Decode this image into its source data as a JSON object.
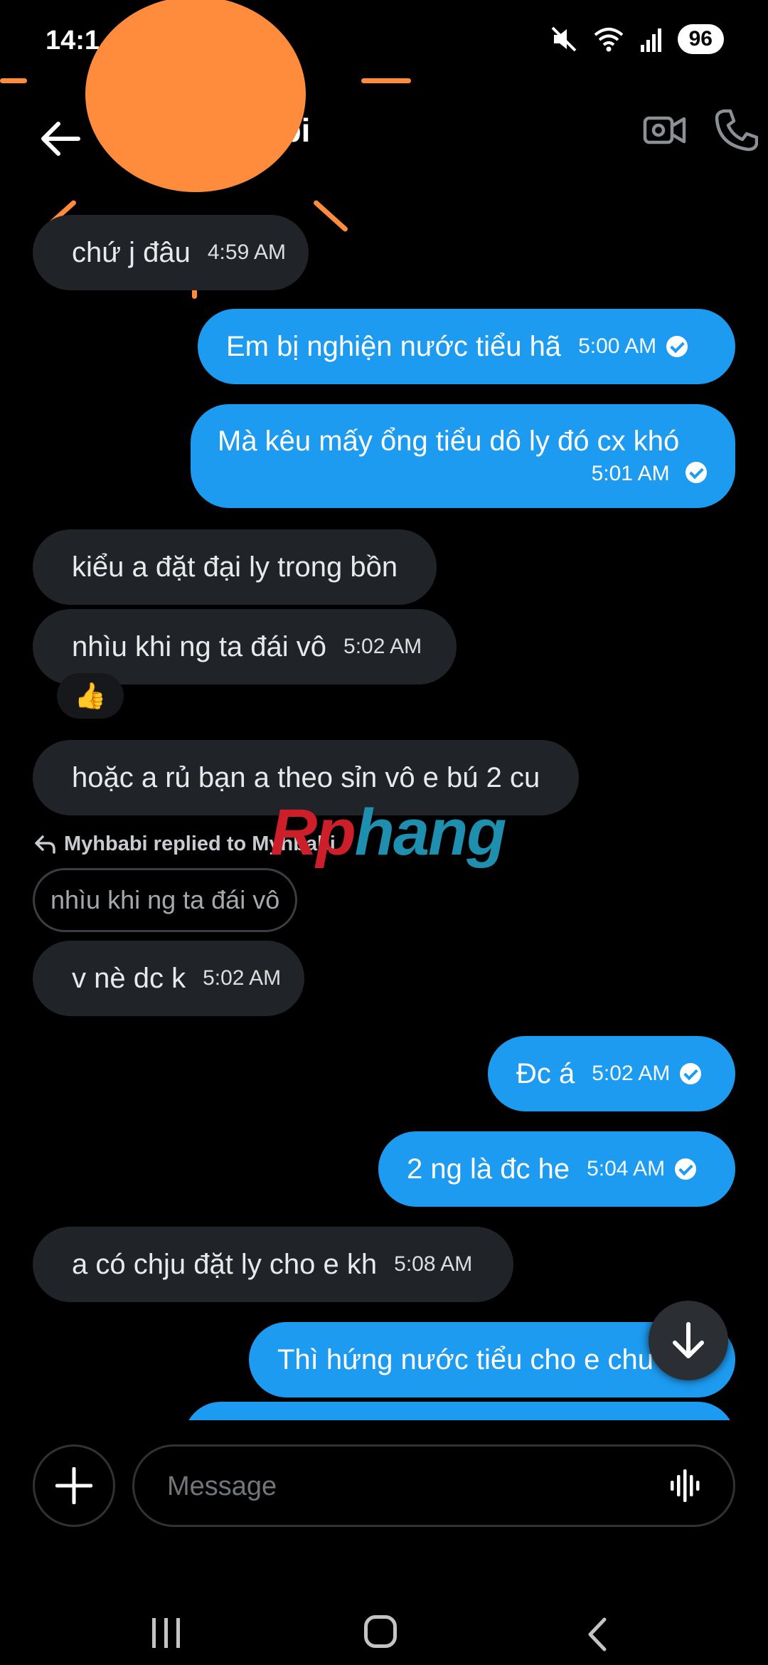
{
  "status_bar": {
    "time": "14:1",
    "battery": "96"
  },
  "header": {
    "name_fragment": "abi"
  },
  "messages": [
    {
      "id": "m1",
      "text": "chứ j đâu",
      "time": "4:59 AM"
    },
    {
      "id": "m2",
      "text": "Em bị nghiện nước tiểu hã",
      "time": "5:00 AM"
    },
    {
      "id": "m3",
      "text": "Mà kêu mấy ổng tiểu dô ly đó cx khó",
      "time": "5:01 AM"
    },
    {
      "id": "m4",
      "text": "kiểu a đặt đại ly trong bồn"
    },
    {
      "id": "m5",
      "text": "nhìu khi ng ta đái vô",
      "time": "5:02 AM",
      "reaction": "👍"
    },
    {
      "id": "m6",
      "text": "hoặc a rủ bạn a theo sỉn vô e bú 2 cu"
    },
    {
      "id": "m7",
      "text": "v nè dc k",
      "time": "5:02 AM"
    },
    {
      "id": "m8",
      "text": "Đc á",
      "time": "5:02 AM"
    },
    {
      "id": "m9",
      "text": "2 ng là đc he",
      "time": "5:04 AM"
    },
    {
      "id": "m10",
      "text": "a có chju đặt ly cho e kh",
      "time": "5:08 AM"
    },
    {
      "id": "m11",
      "text": "Thì hứng nước tiểu cho e chu"
    }
  ],
  "reply": {
    "label": "Myhbabi replied to Myhbabi",
    "quote": "nhìu khi ng ta đái vô"
  },
  "watermark": {
    "part1": "Rp",
    "part2": "hang"
  },
  "composer": {
    "placeholder": "Message"
  },
  "colors": {
    "sent_bubble": "#1d9bf0",
    "received_bubble": "#202327",
    "avatar_redaction": "#ff8c3d"
  }
}
